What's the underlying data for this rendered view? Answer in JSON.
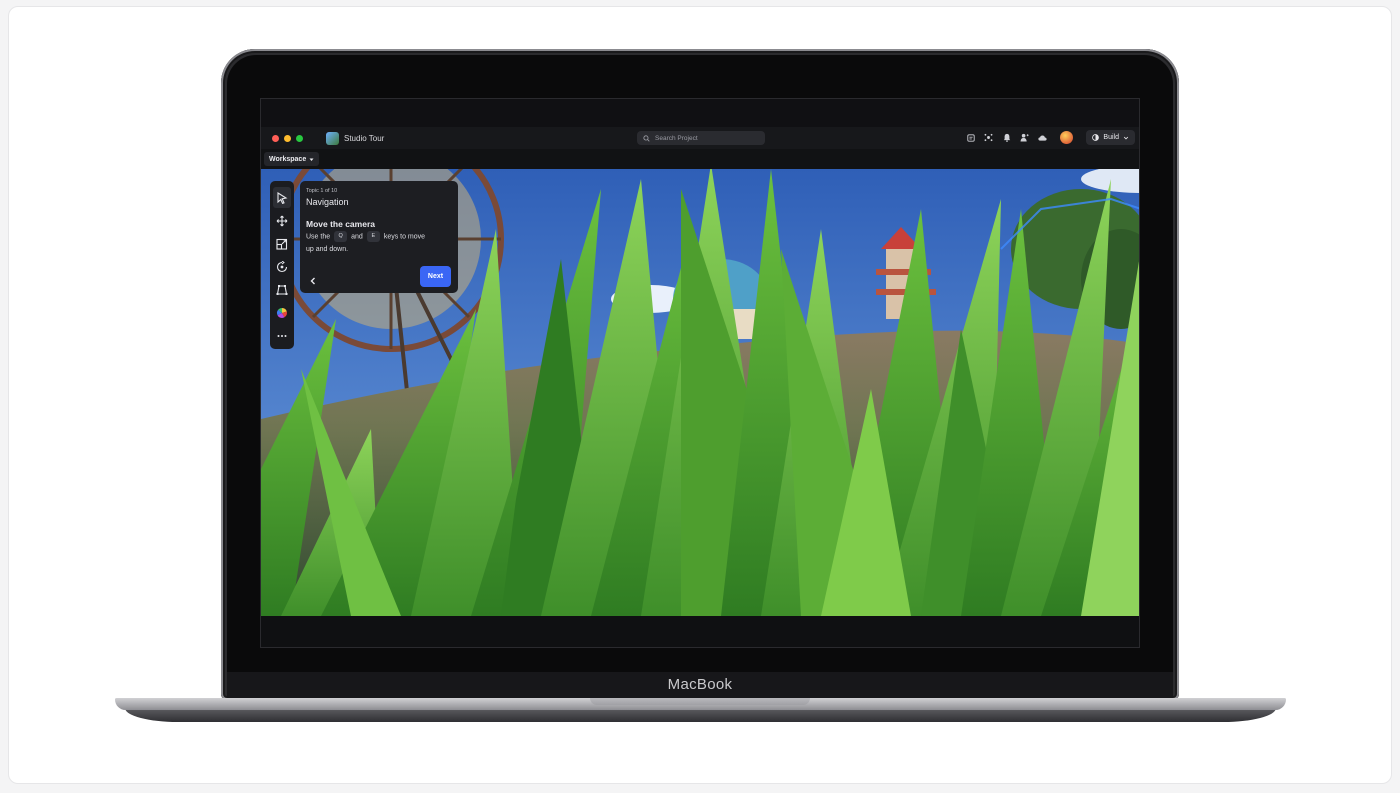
{
  "laptop": {
    "brand_label": "MacBook"
  },
  "window": {
    "title": "Studio Tour",
    "search_placeholder": "Search Project",
    "build_label": "Build",
    "traffic_light_colors": [
      "#ff5f57",
      "#febc2e",
      "#28c840"
    ],
    "header_icons": [
      "notes-icon",
      "collaborate-icon",
      "bell-icon",
      "team-icon",
      "cloud-icon"
    ]
  },
  "menubar": {
    "workspace_label": "Workspace"
  },
  "toolbar": {
    "tools": [
      "select-icon",
      "move-icon",
      "scale-icon",
      "rotate-icon",
      "transform-icon",
      "color-icon",
      "more-icon"
    ]
  },
  "tour": {
    "topic": "Topic 1 of 10",
    "section": "Navigation",
    "step_title": "Move the camera",
    "text_before": "Use the",
    "key_1": "Q",
    "text_mid": "and",
    "key_2": "E",
    "text_after_1": "keys to move",
    "text_after_2": "up and down.",
    "next_label": "Next",
    "accent_color": "#3a66f5"
  }
}
